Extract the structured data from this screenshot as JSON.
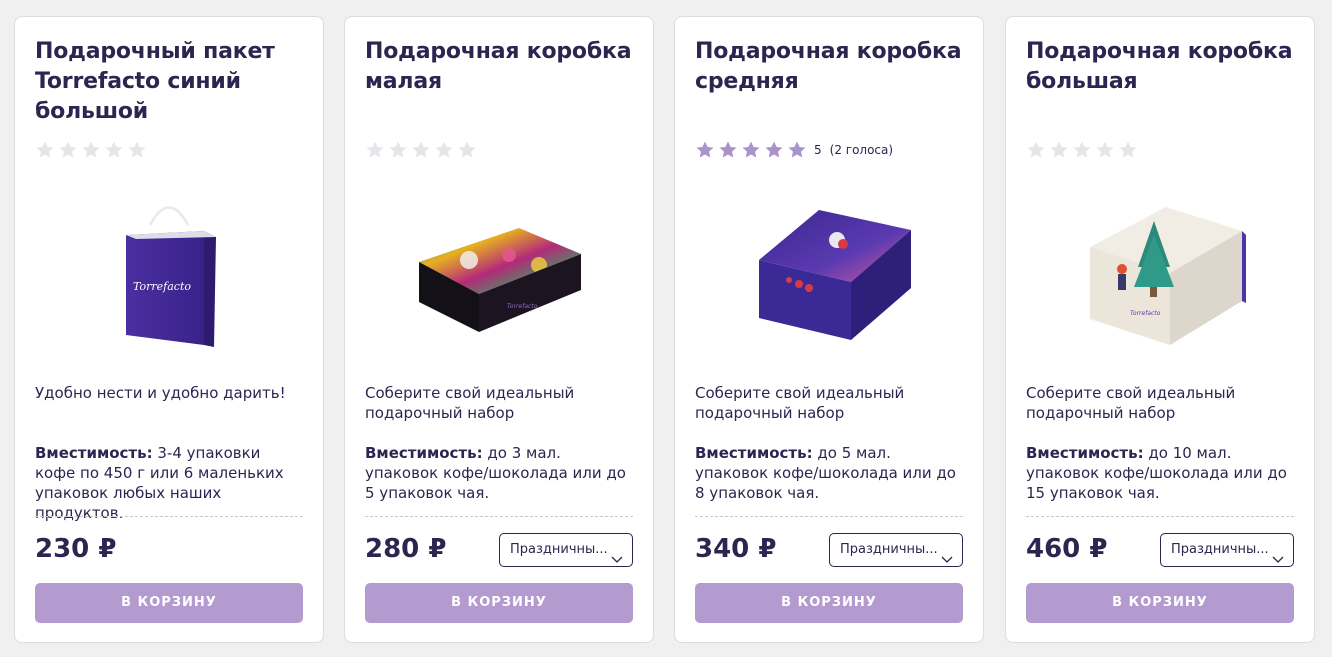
{
  "colors": {
    "accent": "#b39bd0",
    "title": "#2b2650",
    "star_empty": "#e6e6ea",
    "star_filled": "#a993cc"
  },
  "products": [
    {
      "title": "Подарочный пакет Torrefacto синий большой",
      "rating": {
        "filled": 0,
        "value": "",
        "votes": ""
      },
      "image_icon": "gift-bag-image",
      "description": "Удобно нести и удобно дарить!",
      "capacity_label": "Вместимость:",
      "capacity_text": " 3-4 упаковки кофе по 450 г или 6 маленьких упаковок любых наших продуктов.",
      "price": "230 ₽",
      "select_value": "",
      "cart_label": "В КОРЗИНУ"
    },
    {
      "title": "Подарочная коробка малая",
      "rating": {
        "filled": 0,
        "value": "",
        "votes": ""
      },
      "image_icon": "small-box-image",
      "description": "Соберите свой идеальный подарочный набор",
      "capacity_label": "Вместимость:",
      "capacity_text": " до 3 мал. упаковок кофе/шоколада или до 5 упаковок чая.",
      "price": "280 ₽",
      "select_value": "Праздничны...",
      "cart_label": "В КОРЗИНУ"
    },
    {
      "title": "Подарочная коробка средняя",
      "rating": {
        "filled": 5,
        "value": "5",
        "votes": "(2 голоса)"
      },
      "image_icon": "medium-box-image",
      "description": "Соберите свой идеальный подарочный набор",
      "capacity_label": "Вместимость:",
      "capacity_text": " до 5 мал. упаковок кофе/шоколада или до 8 упаковок чая.",
      "price": "340 ₽",
      "select_value": "Праздничны...",
      "cart_label": "В КОРЗИНУ"
    },
    {
      "title": "Подарочная коробка большая",
      "rating": {
        "filled": 0,
        "value": "",
        "votes": ""
      },
      "image_icon": "large-box-image",
      "description": "Соберите свой идеальный подарочный набор",
      "capacity_label": "Вместимость:",
      "capacity_text": " до 10 мал. упаковок кофе/шоколада или до 15 упаковок чая.",
      "price": "460 ₽",
      "select_value": "Праздничны...",
      "cart_label": "В КОРЗИНУ"
    }
  ]
}
